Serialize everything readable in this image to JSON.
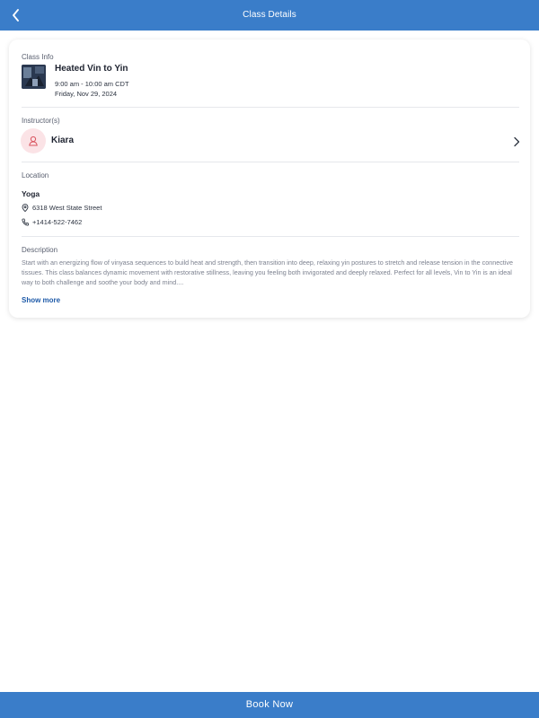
{
  "header": {
    "title": "Class Details",
    "back_icon": "chevron-left-icon",
    "background": "#3a7dc9"
  },
  "class_info": {
    "section_label": "Class Info",
    "name": "Heated Vin to Yin",
    "time": "9:00 am - 10:00 am CDT",
    "date": "Friday, Nov 29, 2024"
  },
  "instructor": {
    "section_label": "Instructor(s)",
    "name": "Kiara",
    "avatar_icon": "person-icon",
    "avatar_bg": "#fbe3e6",
    "chevron_icon": "chevron-right-icon"
  },
  "location": {
    "section_label": "Location",
    "name": "Yoga",
    "address": "6318 West State Street",
    "address_icon": "map-pin-icon",
    "phone": "+1414-522-7462",
    "phone_icon": "phone-icon"
  },
  "description": {
    "section_label": "Description",
    "text": "Start with an energizing flow of vinyasa sequences to build heat and strength, then transition into deep, relaxing yin postures to stretch and release tension in the connective tissues. This class balances dynamic movement with restorative stillness, leaving you feeling both invigorated and deeply relaxed. Perfect for all levels, Vin to Yin is an ideal way to both challenge and soothe your body and mind....",
    "show_more_label": "Show more",
    "link_color": "#1e5aa8"
  },
  "footer": {
    "book_label": "Book Now",
    "background": "#3a7dc9"
  }
}
